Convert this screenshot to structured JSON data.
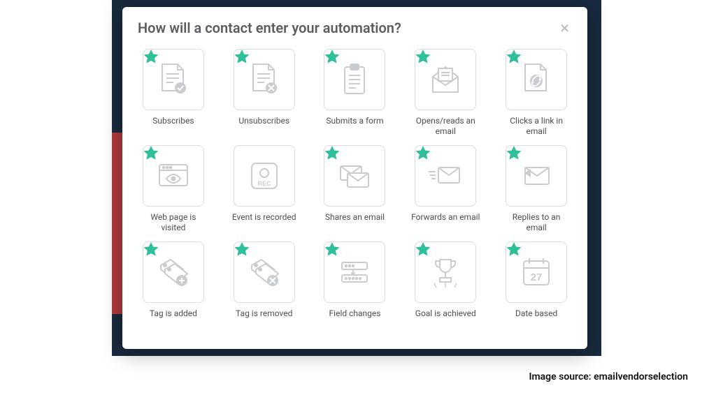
{
  "modal": {
    "title": "How will a contact enter your automation?",
    "close_label": "×"
  },
  "triggers": [
    {
      "label": "Subscribes",
      "icon": "doc-check",
      "starred": true
    },
    {
      "label": "Unsubscribes",
      "icon": "doc-x",
      "starred": true
    },
    {
      "label": "Submits a form",
      "icon": "clipboard",
      "starred": true
    },
    {
      "label": "Opens/reads an email",
      "icon": "envelope-open",
      "starred": true
    },
    {
      "label": "Clicks a link in email",
      "icon": "doc-link",
      "starred": true
    },
    {
      "label": "Web page is visited",
      "icon": "browser-eye",
      "starred": true
    },
    {
      "label": "Event is recorded",
      "icon": "rec",
      "starred": false
    },
    {
      "label": "Shares an email",
      "icon": "envelopes",
      "starred": true
    },
    {
      "label": "Forwards an email",
      "icon": "envelope-fwd",
      "starred": true
    },
    {
      "label": "Replies to an email",
      "icon": "envelope-reply",
      "starred": true
    },
    {
      "label": "Tag is added",
      "icon": "tag-plus",
      "starred": true
    },
    {
      "label": "Tag is removed",
      "icon": "tag-x",
      "starred": true
    },
    {
      "label": "Field changes",
      "icon": "field-change",
      "starred": true
    },
    {
      "label": "Goal is achieved",
      "icon": "trophy",
      "starred": true
    },
    {
      "label": "Date based",
      "icon": "calendar-27",
      "starred": true
    }
  ],
  "attribution": "Image source: emailvendorselection",
  "icons": {
    "calendar_day": "27",
    "rec_label": "REC"
  },
  "colors": {
    "star": "#2fbf9b",
    "stroke": "#c9ccd1",
    "modal_title": "#5a5d63"
  }
}
